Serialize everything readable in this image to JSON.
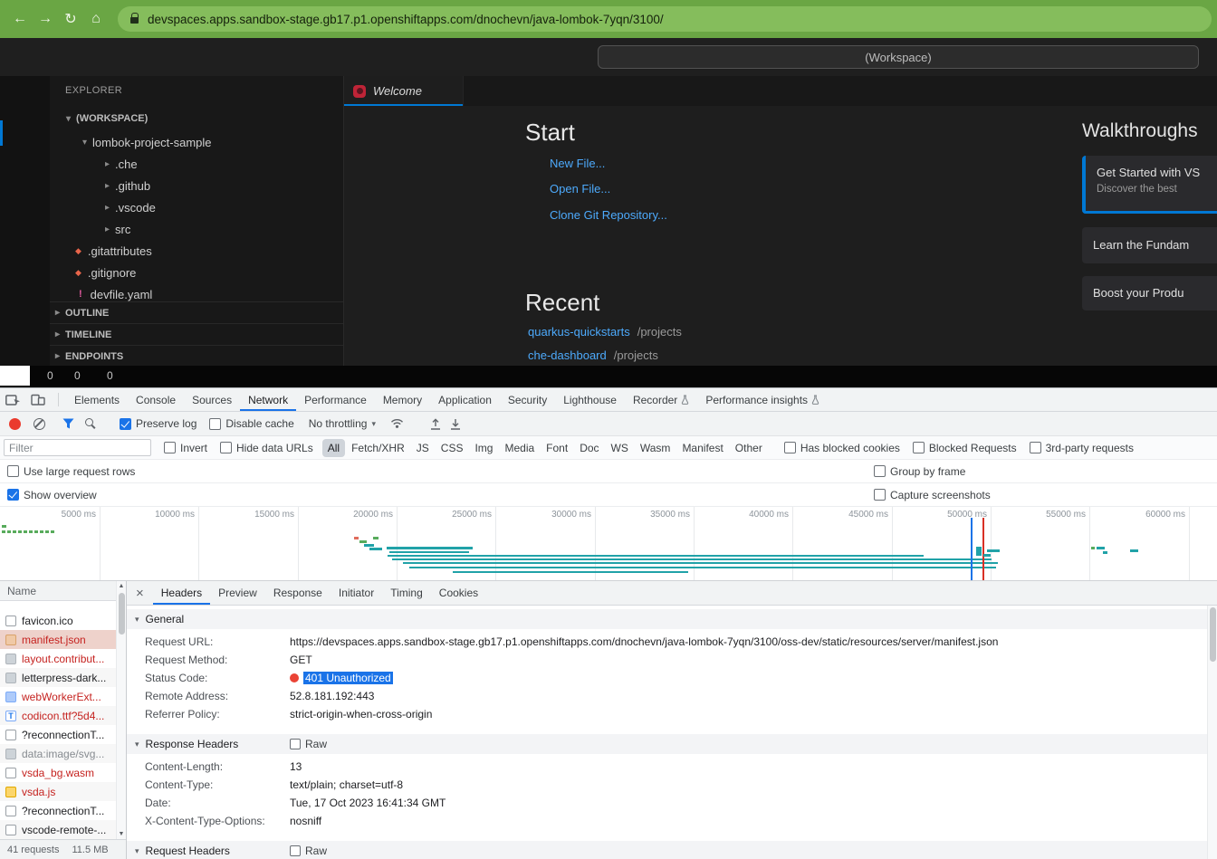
{
  "browser": {
    "url": "devspaces.apps.sandbox-stage.gb17.p1.openshiftapps.com/dnochevn/java-lombok-7yqn/3100/"
  },
  "icons": {
    "back": "←",
    "forward": "→",
    "reload": "↻",
    "home": "⌂",
    "caret_down": "▾",
    "caret_right": "▸",
    "scroll_up": "▲",
    "scroll_down": "▼",
    "close": "×",
    "git_diamond": "◆",
    "yaml_mark": "!",
    "font_file": "T"
  },
  "ide": {
    "command_center": "(Workspace)",
    "explorer_title": "EXPLORER",
    "tree": {
      "root": "(WORKSPACE)",
      "project": "lombok-project-sample",
      "folders": [
        ".che",
        ".github",
        ".vscode",
        "src"
      ],
      "files": [
        ".gitattributes",
        ".gitignore",
        "devfile.yaml"
      ]
    },
    "panels": [
      "OUTLINE",
      "TIMELINE",
      "ENDPOINTS"
    ],
    "tab_welcome": "Welcome",
    "welcome": {
      "start_heading": "Start",
      "links": [
        "New File...",
        "Open File...",
        "Clone Git Repository..."
      ],
      "recent_heading": "Recent",
      "recent": [
        {
          "name": "quarkus-quickstarts",
          "path": "/projects"
        },
        {
          "name": "che-dashboard",
          "path": "/projects"
        }
      ]
    },
    "walkthroughs": {
      "heading": "Walkthroughs",
      "card1_title": "Get Started with VS",
      "card1_sub": "Discover the best",
      "card2_title": "Learn the Fundam",
      "card3_title": "Boost your Produ"
    },
    "status_counts": [
      "0",
      "0",
      "0"
    ]
  },
  "devtools": {
    "tabs": [
      "Elements",
      "Console",
      "Sources",
      "Network",
      "Performance",
      "Memory",
      "Application",
      "Security",
      "Lighthouse",
      "Recorder",
      "Performance insights"
    ],
    "toolbar": {
      "preserve_log": "Preserve log",
      "disable_cache": "Disable cache",
      "throttling": "No throttling"
    },
    "filterbar": {
      "placeholder": "Filter",
      "invert": "Invert",
      "hide_data_urls": "Hide data URLs",
      "chips": [
        "All",
        "Fetch/XHR",
        "JS",
        "CSS",
        "Img",
        "Media",
        "Font",
        "Doc",
        "WS",
        "Wasm",
        "Manifest",
        "Other"
      ],
      "has_blocked_cookies": "Has blocked cookies",
      "blocked_requests": "Blocked Requests",
      "third_party": "3rd-party requests"
    },
    "options": {
      "large_rows": "Use large request rows",
      "group_frame": "Group by frame",
      "show_overview": "Show overview",
      "capture_screenshots": "Capture screenshots"
    },
    "overview_ticks": [
      "5000 ms",
      "10000 ms",
      "15000 ms",
      "20000 ms",
      "25000 ms",
      "30000 ms",
      "35000 ms",
      "40000 ms",
      "45000 ms",
      "50000 ms",
      "55000 ms",
      "60000 ms"
    ],
    "requests": {
      "name_header": "Name",
      "rows": [
        {
          "name": "favicon.ico"
        },
        {
          "name": "manifest.json"
        },
        {
          "name": "layout.contribut..."
        },
        {
          "name": "letterpress-dark..."
        },
        {
          "name": "webWorkerExt..."
        },
        {
          "name": "codicon.ttf?5d4..."
        },
        {
          "name": "?reconnectionT..."
        },
        {
          "name": "data:image/svg..."
        },
        {
          "name": "vsda_bg.wasm"
        },
        {
          "name": "vsda.js"
        },
        {
          "name": "?reconnectionT..."
        },
        {
          "name": "vscode-remote-..."
        }
      ],
      "summary_count": "41 requests",
      "summary_size": "11.5 MB"
    },
    "details": {
      "tabs": [
        "Headers",
        "Preview",
        "Response",
        "Initiator",
        "Timing",
        "Cookies"
      ],
      "raw_label": "Raw",
      "sections": {
        "general": "General",
        "response_headers": "Response Headers",
        "request_headers": "Request Headers"
      },
      "general_rows": [
        {
          "label": "Request URL:",
          "value": "https://devspaces.apps.sandbox-stage.gb17.p1.openshiftapps.com/dnochevn/java-lombok-7yqn/3100/oss-dev/static/resources/server/manifest.json"
        },
        {
          "label": "Request Method:",
          "value": "GET"
        },
        {
          "label": "Status Code:",
          "value": "401 Unauthorized"
        },
        {
          "label": "Remote Address:",
          "value": "52.8.181.192:443"
        },
        {
          "label": "Referrer Policy:",
          "value": "strict-origin-when-cross-origin"
        }
      ],
      "response_rows": [
        {
          "label": "Content-Length:",
          "value": "13"
        },
        {
          "label": "Content-Type:",
          "value": "text/plain; charset=utf-8"
        },
        {
          "label": "Date:",
          "value": "Tue, 17 Oct 2023 16:41:34 GMT"
        },
        {
          "label": "X-Content-Type-Options:",
          "value": "nosniff"
        }
      ]
    },
    "colors": {
      "chrome_green": "#6aa644",
      "url_field_green": "#85bd5c",
      "ide_accent": "#0078d4",
      "link_blue": "#4daafc",
      "devtools_accent": "#1a73e8",
      "error_red": "#c5221f",
      "record_red": "#ea3a2d",
      "overview_teal": "#21a2a8",
      "overview_green": "#58ab5c",
      "selected_row_bg": "#eed2cb"
    }
  }
}
